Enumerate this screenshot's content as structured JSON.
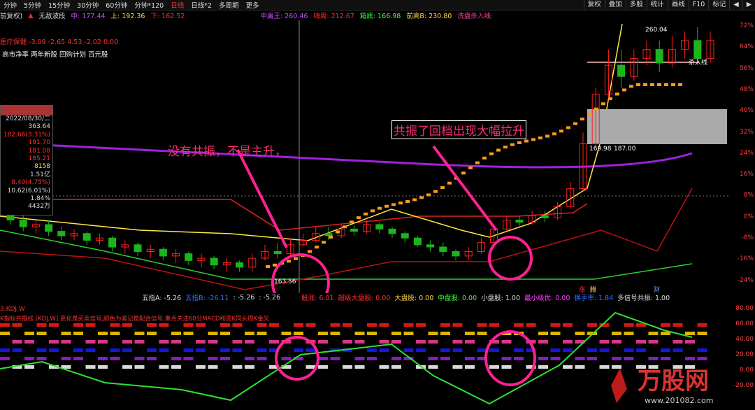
{
  "toolbar": {
    "items": [
      "分钟",
      "5分钟",
      "15分钟",
      "30分钟",
      "60分钟",
      "分钟*120",
      "日线",
      "日线*2",
      "多周期",
      "更多"
    ],
    "active_index": 6,
    "right_buttons": [
      "复权",
      "叠加",
      "多股",
      "统计",
      "画线",
      "F10",
      "标记",
      "◀",
      "▶"
    ]
  },
  "infobar": {
    "prefix": "前复权)",
    "indicator": "无敌波段",
    "zhong": "中: 177.44",
    "shang": "上: 192.36",
    "xia": "下: 162.52",
    "zhongjiang": "中庸王: 260.46",
    "zhongjiang_b": "嗨周: 212.67",
    "qianzhi": "箱底: 166.98",
    "qiangaoB": "前高B: 230.80",
    "xipan": "洗盘杀入线: "
  },
  "top_left": {
    "sector": "医疗保健 -3.09 -2.65 4.53 -2.02 0.00",
    "tags": "高市净率 两年新股 回购计划 百元股"
  },
  "side_panel": {
    "date": "2022/08/30/二",
    "values": [
      "363.64",
      "182.66(3.31%)",
      "191.70",
      "181.08",
      "185.21",
      "8158",
      "1.51亿",
      "8.40(4.75%)",
      "10.62(6.01%)",
      "1.84%",
      "4432万"
    ]
  },
  "annotations": {
    "left": "没有共振，不是主升，",
    "right": "共振了回档出现大幅拉升",
    "price_label_1": "163.56",
    "price_label_2": "169.98",
    "price_label_3": "187.00",
    "price_label_4": "260.04",
    "killline": "杀入线",
    "zhang": "涨",
    "teng": "腾",
    "cai": "财"
  },
  "indicator_row": {
    "wuzhiA": "五指A: -5.26",
    "wuzhiB": "五指B: -26.11",
    "wuzhiC": ": -5.26",
    "wuzhiD": ": -5.26",
    "guzhang": "股涨: 6.01",
    "chaoji": "超级大盘股: 0.00",
    "da": "大盘股: 0.00",
    "zhong": "中盘股: 0.00",
    "xiao": "小盘股: 1.00",
    "zuixiao": "最小级优: 0.00",
    "huanshou": "换手率: 1.84",
    "duoxinhao": "多信号共振: 1.00"
  },
  "sub_panel": {
    "title": "3.KDJ.W",
    "desc": "K指标共振线 [KDJ,W] 变化是买卖信号,颜色为紧记是配合信号,重点关注60分MACD和周K同头周K金叉"
  },
  "chart_data": {
    "type": "candlestick",
    "right_axis_labels": [
      "72%",
      "64%",
      "56%",
      "48%",
      "40%",
      "32%",
      "24%",
      "16%",
      "8%",
      "0%",
      "-8%",
      "-16%",
      "-24%"
    ],
    "sub_axis_labels": [
      "80.00",
      "60.00",
      "40.00",
      "20.00",
      "0.00",
      "-20.00"
    ],
    "candles": [
      {
        "o": 190,
        "c": 186,
        "h": 192,
        "l": 184
      },
      {
        "o": 186,
        "c": 183,
        "h": 188,
        "l": 181
      },
      {
        "o": 183,
        "c": 184,
        "h": 186,
        "l": 180
      },
      {
        "o": 184,
        "c": 181,
        "h": 186,
        "l": 179
      },
      {
        "o": 181,
        "c": 179,
        "h": 183,
        "l": 177
      },
      {
        "o": 179,
        "c": 180,
        "h": 182,
        "l": 177
      },
      {
        "o": 180,
        "c": 177,
        "h": 181,
        "l": 175
      },
      {
        "o": 177,
        "c": 178,
        "h": 180,
        "l": 175
      },
      {
        "o": 178,
        "c": 174,
        "h": 179,
        "l": 172
      },
      {
        "o": 174,
        "c": 175,
        "h": 177,
        "l": 171
      },
      {
        "o": 175,
        "c": 172,
        "h": 176,
        "l": 170
      },
      {
        "o": 172,
        "c": 173,
        "h": 175,
        "l": 169
      },
      {
        "o": 173,
        "c": 170,
        "h": 174,
        "l": 168
      },
      {
        "o": 170,
        "c": 171,
        "h": 173,
        "l": 167
      },
      {
        "o": 171,
        "c": 168,
        "h": 172,
        "l": 166
      },
      {
        "o": 168,
        "c": 169,
        "h": 171,
        "l": 165
      },
      {
        "o": 169,
        "c": 166,
        "h": 170,
        "l": 164
      },
      {
        "o": 166,
        "c": 167,
        "h": 169,
        "l": 163
      },
      {
        "o": 167,
        "c": 165,
        "h": 168,
        "l": 163
      },
      {
        "o": 165,
        "c": 169,
        "h": 171,
        "l": 163
      },
      {
        "o": 169,
        "c": 172,
        "h": 175,
        "l": 168
      },
      {
        "o": 172,
        "c": 171,
        "h": 176,
        "l": 169
      },
      {
        "o": 171,
        "c": 175,
        "h": 178,
        "l": 170
      },
      {
        "o": 175,
        "c": 177,
        "h": 180,
        "l": 174
      },
      {
        "o": 177,
        "c": 180,
        "h": 183,
        "l": 176
      },
      {
        "o": 180,
        "c": 179,
        "h": 183,
        "l": 177
      },
      {
        "o": 179,
        "c": 182,
        "h": 184,
        "l": 178
      },
      {
        "o": 182,
        "c": 181,
        "h": 184,
        "l": 179
      },
      {
        "o": 181,
        "c": 184,
        "h": 186,
        "l": 180
      },
      {
        "o": 184,
        "c": 182,
        "h": 185,
        "l": 180
      },
      {
        "o": 182,
        "c": 180,
        "h": 183,
        "l": 178
      },
      {
        "o": 180,
        "c": 178,
        "h": 181,
        "l": 176
      },
      {
        "o": 178,
        "c": 175,
        "h": 179,
        "l": 174
      },
      {
        "o": 175,
        "c": 174,
        "h": 177,
        "l": 172
      },
      {
        "o": 174,
        "c": 172,
        "h": 176,
        "l": 170
      },
      {
        "o": 172,
        "c": 170,
        "h": 173,
        "l": 168
      },
      {
        "o": 170,
        "c": 172,
        "h": 174,
        "l": 168
      },
      {
        "o": 172,
        "c": 176,
        "h": 178,
        "l": 171
      },
      {
        "o": 176,
        "c": 182,
        "h": 184,
        "l": 175
      },
      {
        "o": 182,
        "c": 186,
        "h": 188,
        "l": 181
      },
      {
        "o": 186,
        "c": 185,
        "h": 188,
        "l": 183
      },
      {
        "o": 185,
        "c": 188,
        "h": 190,
        "l": 184
      },
      {
        "o": 188,
        "c": 187,
        "h": 190,
        "l": 185
      },
      {
        "o": 187,
        "c": 192,
        "h": 194,
        "l": 186
      },
      {
        "o": 192,
        "c": 200,
        "h": 203,
        "l": 191
      },
      {
        "o": 200,
        "c": 220,
        "h": 225,
        "l": 199
      },
      {
        "o": 220,
        "c": 242,
        "h": 245,
        "l": 218
      },
      {
        "o": 242,
        "c": 255,
        "h": 262,
        "l": 240
      },
      {
        "o": 255,
        "c": 250,
        "h": 262,
        "l": 245
      },
      {
        "o": 250,
        "c": 258,
        "h": 262,
        "l": 248
      },
      {
        "o": 258,
        "c": 262,
        "h": 266,
        "l": 255
      },
      {
        "o": 262,
        "c": 256,
        "h": 266,
        "l": 252
      },
      {
        "o": 256,
        "c": 262,
        "h": 268,
        "l": 254
      },
      {
        "o": 262,
        "c": 266,
        "h": 270,
        "l": 258
      },
      {
        "o": 266,
        "c": 258,
        "h": 272,
        "l": 255
      },
      {
        "o": 258,
        "c": 266,
        "h": 270,
        "l": 256
      }
    ]
  }
}
